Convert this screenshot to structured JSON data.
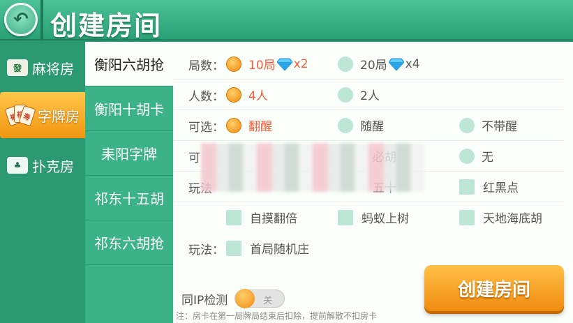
{
  "header": {
    "title": "创建房间"
  },
  "room_types": [
    "麻将房",
    "字牌房",
    "扑克房"
  ],
  "room_icons": {
    "mahjong": "發",
    "card_fan": [
      "福",
      "禄",
      "寿"
    ]
  },
  "games": [
    "衡阳六胡抢",
    "衡阳十胡卡",
    "耒阳字牌",
    "祁东十五胡",
    "祁东六胡抢"
  ],
  "options": {
    "rounds": {
      "label": "局数：",
      "opt1": "10局",
      "opt1_mult": "x2",
      "opt2": "20局",
      "opt2_mult": "x4"
    },
    "players": {
      "label": "人数：",
      "opt1": "4人",
      "opt2": "2人"
    },
    "optional": {
      "label": "可选：",
      "opt1": "翻醒",
      "opt2": "随醒",
      "opt3": "不带醒"
    },
    "row4": {
      "label": "可",
      "opt2": "必胡",
      "opt3": "无"
    },
    "play1": {
      "label": "玩法",
      "opt2": "五十",
      "opt3": "红黑点"
    },
    "play2": {
      "opt1": "自摸翻倍",
      "opt2": "蚂蚁上树",
      "opt3": "天地海底胡"
    },
    "play3": {
      "label": "玩法：",
      "opt1": "首局随机庄"
    }
  },
  "ip_check": {
    "label": "同IP检测",
    "state": "关"
  },
  "note": "注：房卡在第一局牌局结束后扣除，提前解散不扣房卡",
  "create_button": "创建房间",
  "colors": {
    "accent": "#f29612",
    "selected_text": "#ff5a3a",
    "bg": "#2a9a72"
  }
}
